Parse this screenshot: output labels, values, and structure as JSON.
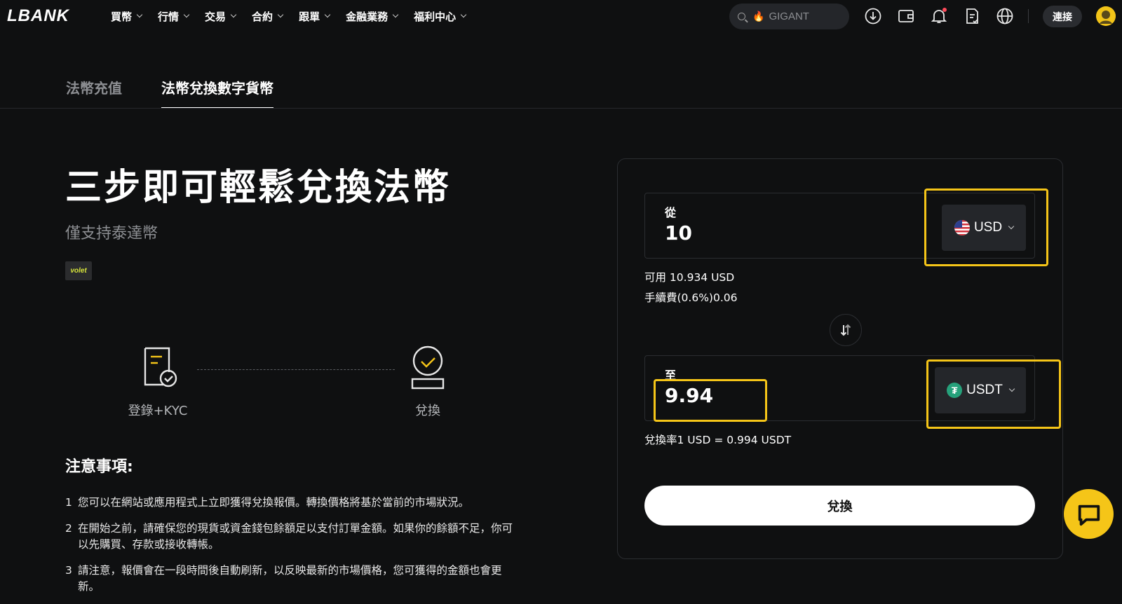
{
  "brand": {
    "logo_text": "LBANK"
  },
  "nav": {
    "menu": [
      {
        "label": "買幣"
      },
      {
        "label": "行情"
      },
      {
        "label": "交易"
      },
      {
        "label": "合約"
      },
      {
        "label": "跟單"
      },
      {
        "label": "金融業務"
      },
      {
        "label": "福利中心"
      }
    ],
    "search": {
      "value": "GIGANT"
    },
    "icons": [
      "download-icon",
      "wallet-icon",
      "bell-icon",
      "document-icon",
      "globe-icon"
    ],
    "connect_label": "連接"
  },
  "tabs": [
    {
      "label": "法幣充值",
      "active": false
    },
    {
      "label": "法幣兌換數字貨幣",
      "active": true
    }
  ],
  "hero": {
    "title": "三步即可輕鬆兌換法幣",
    "subtitle": "僅支持泰達幣",
    "badge": "volet"
  },
  "steps": [
    {
      "label": "登錄+KYC",
      "icon": "kyc-document-icon"
    },
    {
      "label": "兌換",
      "icon": "exchange-check-icon"
    }
  ],
  "notes": {
    "title": "注意事項:",
    "items": [
      {
        "num": "1",
        "text": "您可以在網站或應用程式上立即獲得兌換報價。轉換價格將基於當前的市場狀況。"
      },
      {
        "num": "2",
        "text": "在開始之前，請確保您的現貨或資金錢包餘額足以支付訂單金額。如果你的餘額不足，你可以先購買、存款或接收轉帳。"
      },
      {
        "num": "3",
        "text": "請注意，報價會在一段時間後自動刷新，以反映最新的市場價格，您可獲得的金額也會更新。"
      }
    ]
  },
  "exchange": {
    "from": {
      "label": "從",
      "value": "10",
      "currency": "USD"
    },
    "available": "可用 10.934 USD",
    "fee": "手續費(0.6%)0.06",
    "to": {
      "label": "至",
      "value": "9.94",
      "currency": "USDT"
    },
    "rate": "兌換率1 USD = 0.994 USDT",
    "button_label": "兌換"
  },
  "colors": {
    "background": "#0f1011",
    "highlight": "#f5c518",
    "tether": "#26a17b"
  }
}
